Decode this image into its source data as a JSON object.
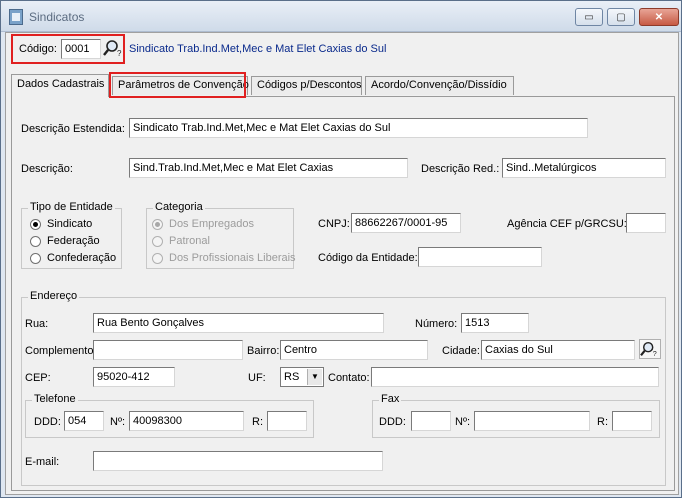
{
  "window": {
    "title": "Sindicatos",
    "buttons": {
      "minimize": "▭",
      "maximize": "▢",
      "close": "✕"
    }
  },
  "header": {
    "codigo_label": "Código:",
    "codigo_value": "0001",
    "sindicato_name": "Sindicato Trab.Ind.Met,Mec e Mat Elet Caxias do Sul"
  },
  "tabs": [
    {
      "label": "Dados Cadastrais"
    },
    {
      "label": "Parâmetros de Convenção"
    },
    {
      "label": "Códigos p/Descontos"
    },
    {
      "label": "Acordo/Convenção/Dissídio"
    }
  ],
  "form": {
    "descricao_estendida_label": "Descrição Estendida:",
    "descricao_estendida_value": "Sindicato Trab.Ind.Met,Mec e Mat Elet Caxias do Sul",
    "descricao_label": "Descrição:",
    "descricao_value": "Sind.Trab.Ind.Met,Mec e Mat Elet Caxias",
    "descricao_red_label": "Descrição Red.:",
    "descricao_red_value": "Sind..Metalúrgicos",
    "tipo_entidade": {
      "legend": "Tipo de Entidade",
      "options": [
        "Sindicato",
        "Federação",
        "Confederação"
      ],
      "selected": "Sindicato"
    },
    "categoria": {
      "legend": "Categoria",
      "options": [
        "Dos Empregados",
        "Patronal",
        "Dos Profissionais Liberais"
      ],
      "selected": "Dos Empregados"
    },
    "cnpj_label": "CNPJ:",
    "cnpj_value": "88662267/0001-95",
    "agencia_label": "Agência CEF p/GRCSU:",
    "agencia_value": "",
    "codigo_entidade_label": "Código da Entidade:",
    "codigo_entidade_value": ""
  },
  "endereco": {
    "legend": "Endereço",
    "rua_label": "Rua:",
    "rua_value": "Rua Bento Gonçalves",
    "numero_label": "Número:",
    "numero_value": "1513",
    "complemento_label": "Complemento:",
    "complemento_value": "",
    "bairro_label": "Bairro:",
    "bairro_value": "Centro",
    "cidade_label": "Cidade:",
    "cidade_value": "Caxias do Sul",
    "cep_label": "CEP:",
    "cep_value": "95020-412",
    "uf_label": "UF:",
    "uf_value": "RS",
    "contato_label": "Contato:",
    "contato_value": ""
  },
  "telefone": {
    "legend": "Telefone",
    "ddd_label": "DDD:",
    "ddd_value": "054",
    "numero_label": "Nº:",
    "numero_value": "40098300",
    "ramal_label": "R:",
    "ramal_value": ""
  },
  "fax": {
    "legend": "Fax",
    "ddd_label": "DDD:",
    "ddd_value": "",
    "numero_label": "Nº:",
    "numero_value": "",
    "ramal_label": "R:",
    "ramal_value": ""
  },
  "email": {
    "label": "E-mail:",
    "value": ""
  },
  "colors": {
    "highlight": "#e02020",
    "link_text": "#0a2a8c"
  }
}
